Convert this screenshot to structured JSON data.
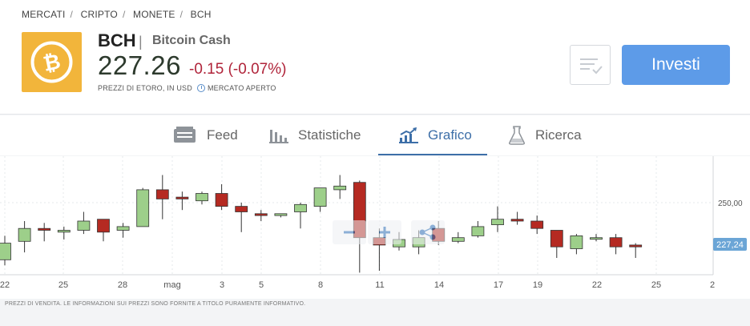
{
  "breadcrumb": {
    "items": [
      "MERCATI",
      "CRIPTO",
      "MONETE",
      "BCH"
    ],
    "separator": "/"
  },
  "asset": {
    "symbol": "BCH",
    "name": "Bitcoin Cash",
    "price": "227.26",
    "change": "-0.15 (-0.07%)",
    "price_source": "PREZZI DI ETORO, IN USD",
    "market_status": "MERCATO APERTO",
    "logo_icon": "bitcoin-logo",
    "logo_color": "#f2b53b"
  },
  "actions": {
    "watchlist_icon": "watchlist-check-icon",
    "invest_label": "Investi",
    "invest_color": "#5d9be8"
  },
  "tabs": [
    {
      "label": "Feed",
      "icon": "feed-icon",
      "active": false
    },
    {
      "label": "Statistiche",
      "icon": "bar-stats-icon",
      "active": false
    },
    {
      "label": "Grafico",
      "icon": "chart-trend-icon",
      "active": true
    },
    {
      "label": "Ricerca",
      "icon": "flask-icon",
      "active": false
    }
  ],
  "chart_data": {
    "type": "candlestick",
    "x_tick_labels": [
      "22",
      "25",
      "28",
      "mag",
      "3",
      "5",
      "8",
      "11",
      "14",
      "17",
      "19",
      "22",
      "25",
      "2"
    ],
    "y_tick_labels": [
      "250,00"
    ],
    "current_price_label": "227,24",
    "up_color": "#9dcf8a",
    "down_color": "#b52a22",
    "candles": [
      {
        "o": 219,
        "h": 232,
        "l": 216,
        "c": 228
      },
      {
        "o": 229,
        "h": 240,
        "l": 223,
        "c": 236
      },
      {
        "o": 236,
        "h": 239,
        "l": 229,
        "c": 235
      },
      {
        "o": 234,
        "h": 237,
        "l": 230,
        "c": 235
      },
      {
        "o": 235,
        "h": 245,
        "l": 233,
        "c": 240
      },
      {
        "o": 241,
        "h": 241,
        "l": 229,
        "c": 234
      },
      {
        "o": 235,
        "h": 239,
        "l": 231,
        "c": 237
      },
      {
        "o": 237,
        "h": 258,
        "l": 237,
        "c": 257
      },
      {
        "o": 257,
        "h": 265,
        "l": 241,
        "c": 252
      },
      {
        "o": 253,
        "h": 256,
        "l": 246,
        "c": 252
      },
      {
        "o": 251,
        "h": 256,
        "l": 249,
        "c": 255
      },
      {
        "o": 255,
        "h": 260,
        "l": 246,
        "c": 248
      },
      {
        "o": 248,
        "h": 250,
        "l": 234,
        "c": 245
      },
      {
        "o": 244,
        "h": 246,
        "l": 240,
        "c": 243
      },
      {
        "o": 243,
        "h": 244,
        "l": 242,
        "c": 244
      },
      {
        "o": 245,
        "h": 250,
        "l": 236,
        "c": 249
      },
      {
        "o": 248,
        "h": 253,
        "l": 245,
        "c": 258
      },
      {
        "o": 257,
        "h": 265,
        "l": 252,
        "c": 259
      },
      {
        "o": 261,
        "h": 262,
        "l": 212,
        "c": 231
      },
      {
        "o": 231,
        "h": 236,
        "l": 213,
        "c": 227
      },
      {
        "o": 226,
        "h": 234,
        "l": 224,
        "c": 230
      },
      {
        "o": 226,
        "h": 235,
        "l": 222,
        "c": 231
      },
      {
        "o": 236,
        "h": 240,
        "l": 227,
        "c": 229
      },
      {
        "o": 229,
        "h": 234,
        "l": 228,
        "c": 231
      },
      {
        "o": 232,
        "h": 240,
        "l": 231,
        "c": 237
      },
      {
        "o": 238,
        "h": 248,
        "l": 234,
        "c": 241
      },
      {
        "o": 241,
        "h": 245,
        "l": 238,
        "c": 240
      },
      {
        "o": 240,
        "h": 243,
        "l": 233,
        "c": 236
      },
      {
        "o": 235,
        "h": 235,
        "l": 220,
        "c": 226
      },
      {
        "o": 225,
        "h": 233,
        "l": 222,
        "c": 232
      },
      {
        "o": 231,
        "h": 233,
        "l": 229,
        "c": 231
      },
      {
        "o": 231,
        "h": 233,
        "l": 222,
        "c": 226
      },
      {
        "o": 227,
        "h": 228,
        "l": 220,
        "c": 226
      }
    ],
    "controls": [
      "zoom-out-icon",
      "zoom-in-icon",
      "pan-icon",
      "share-icon"
    ]
  },
  "footer_note": "PREZZI DI VENDITA. LE INFORMAZIONI SUI PREZZI SONO FORNITE A TITOLO PURAMENTE INFORMATIVO."
}
